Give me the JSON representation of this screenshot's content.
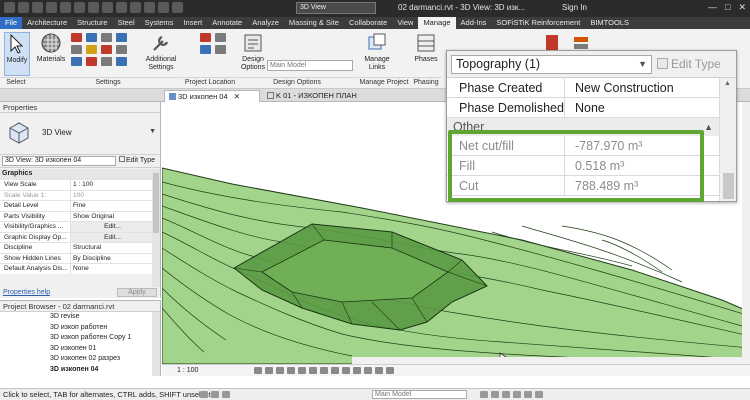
{
  "app": {
    "view_combo": "3D View",
    "document_title": "02 darmanci.rvt - 3D View: 3D изк...",
    "sign_in": "Sign In"
  },
  "ribbon": {
    "tabs": [
      "File",
      "Architecture",
      "Structure",
      "Steel",
      "Systems",
      "Insert",
      "Annotate",
      "Analyze",
      "Massing & Site",
      "Collaborate",
      "View",
      "Manage",
      "Add-Ins",
      "SOFiSTiK Reinforcement",
      "BIMTOOLS"
    ],
    "active_tab": "Manage",
    "modify_label": "Modify",
    "materials_label": "Materials",
    "additional_settings_label": "Additional Settings",
    "design_options_label": "Design Options",
    "main_model_combo": "Main Model",
    "manage_links_label": "Manage Links",
    "phases_label": "Phases",
    "groups": {
      "select": "Select",
      "settings": "Settings",
      "project_location": "Project Location",
      "design_options": "Design Options",
      "manage_project": "Manage Project",
      "phasing": "Phasing"
    }
  },
  "view_tabs": {
    "active": "3D изкопен 04",
    "other": "K 01 - ИЗКОПЕН ПЛАН"
  },
  "properties": {
    "header": "Properties",
    "type_name": "3D View",
    "instance_combo": "3D View: 3D изкопен 04",
    "edit_type": "Edit Type",
    "category": "Graphics",
    "rows": [
      {
        "name": "View Scale",
        "value": "1 : 100",
        "gray": false
      },
      {
        "name": "Scale Value    1:",
        "value": "100",
        "gray": true
      },
      {
        "name": "Detail Level",
        "value": "Fine",
        "gray": false
      },
      {
        "name": "Parts Visibility",
        "value": "Show Original",
        "gray": false
      },
      {
        "name": "Visibility/Graphics ...",
        "value": "Edit...",
        "gray": false,
        "button": true
      },
      {
        "name": "Graphic Display Op...",
        "value": "Edit...",
        "gray": false,
        "button": true
      },
      {
        "name": "Discipline",
        "value": "Structural",
        "gray": false
      },
      {
        "name": "Show Hidden Lines",
        "value": "By Discipline",
        "gray": false
      },
      {
        "name": "Default Analysis Dis...",
        "value": "None",
        "gray": false
      }
    ],
    "help_link": "Properties help",
    "apply": "Apply"
  },
  "browser": {
    "header": "Project Browser - 02 darmanci.rvt",
    "items": [
      "3D revise",
      "3D изкоп работен",
      "3D изкоп работен Copy 1",
      "3D изкопен 01",
      "3D изкопен 02 разрез",
      "3D изкопен 04"
    ],
    "active_item": "3D изкопен 04"
  },
  "view_control": {
    "scale": "1 : 100"
  },
  "zoom_panel": {
    "type_combo": "Topography (1)",
    "edit_type": "Edit Type",
    "rows": [
      {
        "name": "Phase Created",
        "value": "New Construction"
      },
      {
        "name": "Phase Demolished",
        "value": "None"
      }
    ],
    "category": "Other",
    "computed_rows": [
      {
        "name": "Net cut/fill",
        "value": "-787.970 m³"
      },
      {
        "name": "Fill",
        "value": "0.518 m³"
      },
      {
        "name": "Cut",
        "value": "788.489 m³"
      }
    ],
    "highlight_color": "#5ea531"
  },
  "status": {
    "text": "Click to select, TAB for alternates, CTRL adds, SHIFT unselect",
    "model_combo": "Main Model"
  },
  "colors": {
    "file_tab": "#2f6dc6",
    "terrain_fill": "#9fce8a",
    "terrain_line": "#1f3d15",
    "excavation": "#4d8f3a"
  }
}
